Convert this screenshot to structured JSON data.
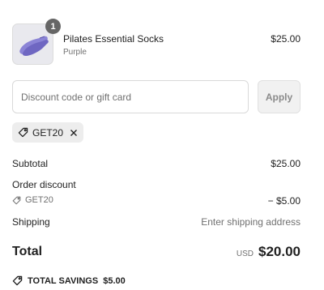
{
  "product": {
    "name": "Pilates Essential Socks",
    "variant": "Purple",
    "price": "$25.00",
    "quantity": "1",
    "image_icon": "sock-image"
  },
  "discount": {
    "placeholder": "Discount code or gift card",
    "apply_label": "Apply",
    "applied_code": "GET20"
  },
  "summary": {
    "subtotal_label": "Subtotal",
    "subtotal_value": "$25.00",
    "order_discount_label": "Order discount",
    "discount_code": "GET20",
    "discount_value": "− $5.00",
    "shipping_label": "Shipping",
    "shipping_value": "Enter shipping address",
    "total_label": "Total",
    "currency": "USD",
    "total_value": "$20.00",
    "savings_label": "TOTAL SAVINGS",
    "savings_value": "$5.00"
  },
  "colors": {
    "sock": "#7b73c9",
    "badge": "#666666",
    "chip_bg": "#ededed"
  }
}
